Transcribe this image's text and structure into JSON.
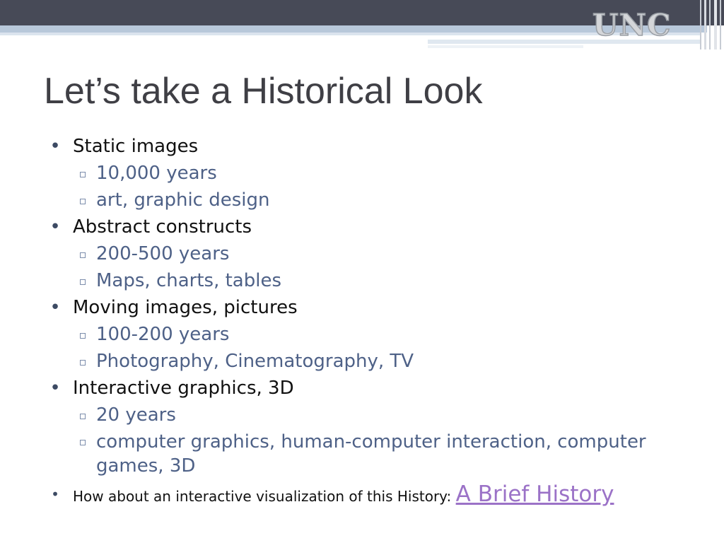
{
  "header": {
    "logo_text": "UNC",
    "colors": {
      "band": "#474a57",
      "stripe": "#b8c8da",
      "title": "#3f3f45",
      "sub_text": "#4e6187",
      "link": "#9b72c7"
    }
  },
  "slide": {
    "title": "Let’s take a Historical Look",
    "bullet_glyph": "•",
    "sub_bullet_glyph": "▫",
    "items": [
      {
        "label": "Static images",
        "subs": [
          "10,000 years",
          "art, graphic design"
        ]
      },
      {
        "label": "Abstract constructs",
        "subs": [
          "200-500 years",
          "Maps, charts, tables"
        ]
      },
      {
        "label": "Moving images, pictures",
        "subs": [
          "100-200 years",
          "Photography, Cinematography, TV"
        ]
      },
      {
        "label": "Interactive graphics, 3D",
        "subs": [
          "20 years",
          "computer graphics, human-computer interaction, computer games, 3D"
        ]
      }
    ],
    "final_item": {
      "text": "How about an interactive visualization of this History: ",
      "link_text": "A Brief History"
    }
  }
}
